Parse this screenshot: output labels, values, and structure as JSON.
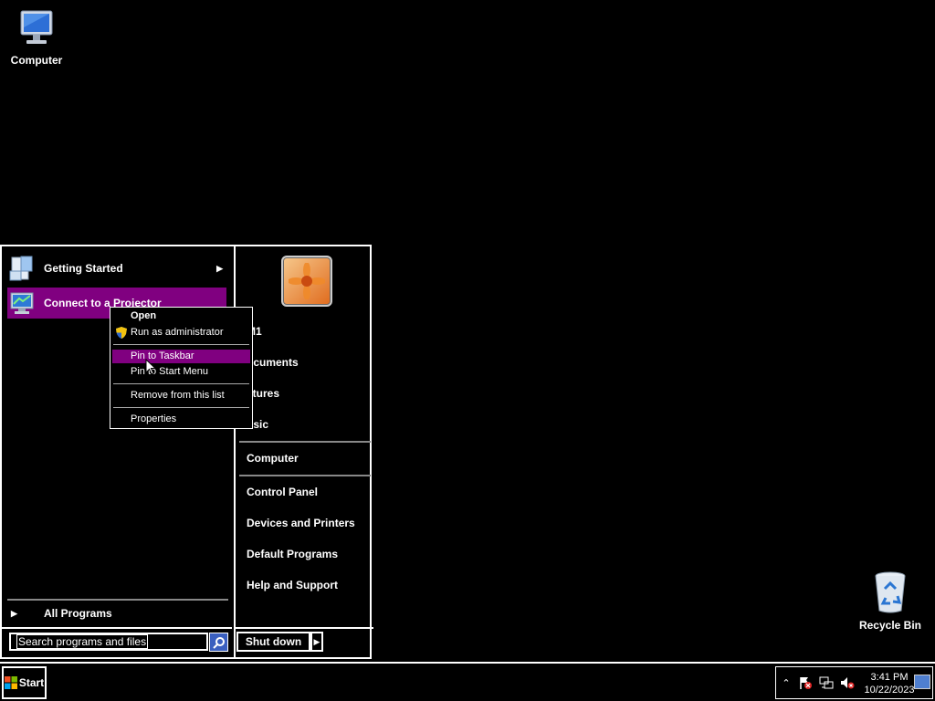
{
  "desktop": {
    "icons": [
      {
        "label": "Computer",
        "icon": "computer-icon"
      },
      {
        "label": "Recycle Bin",
        "icon": "recycle-bin-icon"
      }
    ]
  },
  "start_menu": {
    "programs": [
      {
        "label": "Getting Started",
        "icon": "getting-started-icon",
        "has_submenu": true
      },
      {
        "label": "Connect to a Projector",
        "icon": "projector-icon",
        "selected": true
      }
    ],
    "all_programs": "All Programs",
    "search_placeholder": "Search programs and files",
    "shutdown_label": "Shut down",
    "right_items": [
      {
        "label": "M1"
      },
      {
        "label": "ocuments"
      },
      {
        "label": "ctures"
      },
      {
        "label": "usic"
      },
      {
        "label": "Computer"
      },
      {
        "label": "Control Panel"
      },
      {
        "label": "Devices and Printers"
      },
      {
        "label": "Default Programs"
      },
      {
        "label": "Help and Support"
      }
    ]
  },
  "context_menu": {
    "items": [
      {
        "label": "Open",
        "bold": true
      },
      {
        "label": "Run as administrator",
        "icon": "uac-shield-icon"
      },
      {
        "label": "Pin to Taskbar",
        "highlighted": true
      },
      {
        "label": "Pin to Start Menu"
      },
      {
        "label": "Remove from this list"
      },
      {
        "label": "Properties"
      }
    ]
  },
  "taskbar": {
    "start_label": "Start",
    "clock_time": "3:41 PM",
    "clock_date": "10/22/2023",
    "tray_icons": [
      "show-hidden-icons-chevron",
      "action-center-flag-icon",
      "network-icon",
      "volume-muted-icon"
    ]
  },
  "colors": {
    "highlight": "#800080",
    "background": "#000000",
    "border": "#ffffff"
  }
}
